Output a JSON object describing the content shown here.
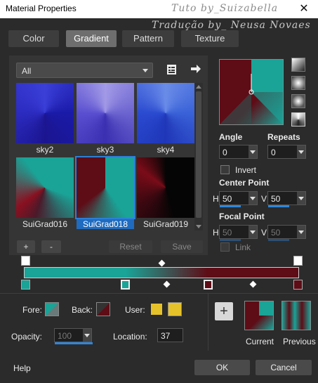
{
  "window": {
    "title": "Material Properties",
    "close_glyph": "✕"
  },
  "watermarks": {
    "line1": "Tuto by_Suizabella",
    "line2": "Tradução by_ Neusa Novaes"
  },
  "tabs": [
    {
      "label": "Color"
    },
    {
      "label": "Gradient"
    },
    {
      "label": "Pattern"
    },
    {
      "label": "Texture"
    }
  ],
  "library": {
    "filter_value": "All",
    "items": [
      {
        "label": "sky2"
      },
      {
        "label": "sky3"
      },
      {
        "label": "sky4"
      },
      {
        "label": "SuiGrad016"
      },
      {
        "label": "SuiGrad018",
        "selected": true
      },
      {
        "label": "SuiGrad019"
      }
    ],
    "add_label": "+",
    "remove_label": "-",
    "reset_label": "Reset",
    "save_label": "Save"
  },
  "settings": {
    "angle_label": "Angle",
    "angle_value": "0",
    "repeats_label": "Repeats",
    "repeats_value": "0",
    "invert_label": "Invert",
    "center_point_label": "Center Point",
    "center_h_label": "H",
    "center_h_value": "50",
    "center_v_label": "V",
    "center_v_value": "50",
    "focal_point_label": "Focal Point",
    "focal_h_label": "H",
    "focal_h_value": "50",
    "focal_v_label": "V",
    "focal_v_value": "50",
    "link_label": "Link"
  },
  "stops": {
    "fore_label": "Fore:",
    "back_label": "Back:",
    "user_label": "User:",
    "opacity_label": "Opacity:",
    "opacity_value": "100",
    "location_label": "Location:",
    "location_value": "37",
    "user_color": "#e6c22a"
  },
  "compare": {
    "add_label": "+",
    "current_label": "Current",
    "previous_label": "Previous"
  },
  "footer": {
    "help_label": "Help",
    "ok_label": "OK",
    "cancel_label": "Cancel"
  },
  "colors": {
    "teal": "#1aa397",
    "maroon": "#5e0c16",
    "accent": "#2b7fd8"
  }
}
